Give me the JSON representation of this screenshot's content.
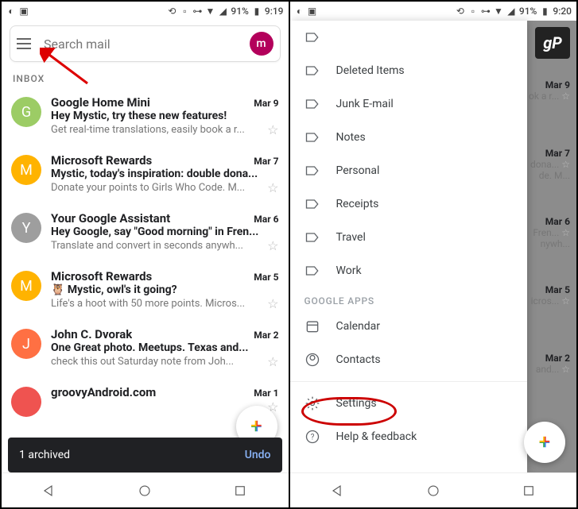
{
  "statusbar": {
    "battery": "91%",
    "time1": "9:19",
    "time2": "9:20"
  },
  "search": {
    "placeholder": "Search mail",
    "avatar_letter": "m"
  },
  "inbox_label": "INBOX",
  "mails": [
    {
      "avatar": "G",
      "color": "#9ccc65",
      "sender": "Google Home Mini",
      "date": "Mar 9",
      "subject": "Hey Mystic, try these new features!",
      "snippet": "Get real-time translations, easily book a r..."
    },
    {
      "avatar": "M",
      "color": "#ffb300",
      "sender": "Microsoft Rewards",
      "date": "Mar 7",
      "subject": "Mystic, today's inspiration: double dona...",
      "snippet": "Donate your points to Girls Who Code. M..."
    },
    {
      "avatar": "Y",
      "color": "#9e9e9e",
      "sender": "Your Google Assistant",
      "date": "Mar 6",
      "subject": "Hey Google, say \"Good morning\" in Fren...",
      "snippet": "Translate and convert in seconds anywh..."
    },
    {
      "avatar": "M",
      "color": "#ffb300",
      "sender": "Microsoft Rewards",
      "date": "Mar 5",
      "subject": "🦉 Mystic, owl's it going?",
      "snippet": "Life's a hoot with 50 more points. Micros..."
    },
    {
      "avatar": "J",
      "color": "#ff7043",
      "sender": "John C. Dvorak",
      "date": "Mar 2",
      "subject": "One Great photo. Meetups. Texas and...",
      "snippet": "check this out Saturday note from Joh..."
    },
    {
      "avatar": "",
      "color": "#ef5350",
      "sender": "groovyAndroid.com",
      "date": "Mar 1",
      "subject": "",
      "snippet": ""
    }
  ],
  "snackbar": {
    "msg": "1 archived",
    "action": "Undo"
  },
  "drawer": {
    "folders": [
      {
        "label": ""
      },
      {
        "label": "Deleted Items"
      },
      {
        "label": "Junk E-mail"
      },
      {
        "label": "Notes"
      },
      {
        "label": "Personal"
      },
      {
        "label": "Receipts"
      },
      {
        "label": "Travel"
      },
      {
        "label": "Work"
      }
    ],
    "section": "GOOGLE APPS",
    "apps": [
      {
        "label": "Calendar"
      },
      {
        "label": "Contacts"
      }
    ],
    "menu": [
      {
        "label": "Settings"
      },
      {
        "label": "Help & feedback"
      }
    ]
  },
  "gp": "gP",
  "bg_mail_peek": [
    {
      "date": "Mar 9",
      "snip": "ok a r...",
      "star": true
    },
    {
      "date": "Mar 7",
      "snip": "dona...",
      "snip2": "de. M..."
    },
    {
      "date": "Mar 6",
      "snip": "Fren...",
      "snip2": "nywh..."
    },
    {
      "date": "Mar 5",
      "snip": "icros..."
    },
    {
      "date": "Mar 2",
      "snip": "and..."
    }
  ]
}
